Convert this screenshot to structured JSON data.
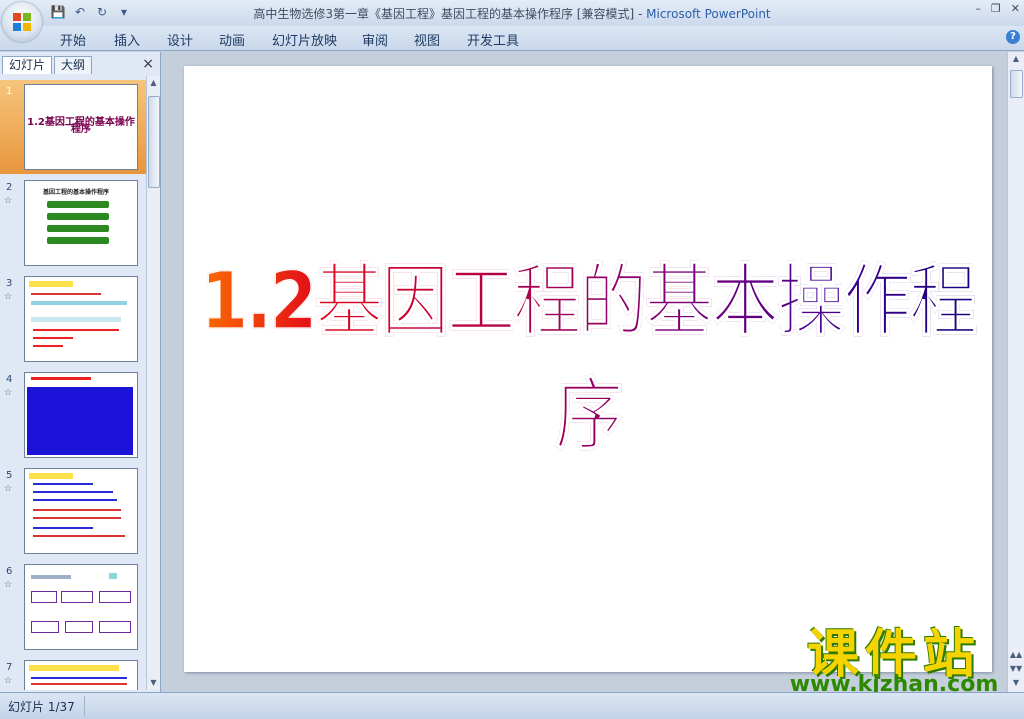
{
  "window": {
    "title": "高中生物选修3第一章《基因工程》基因工程的基本操作程序 [兼容模式]",
    "app_name": "Microsoft PowerPoint",
    "title_separator": " - "
  },
  "ribbon": {
    "tabs": [
      "开始",
      "插入",
      "设计",
      "动画",
      "幻灯片放映",
      "审阅",
      "视图",
      "开发工具"
    ]
  },
  "panel": {
    "tab_slides": "幻灯片",
    "tab_outline": "大纲",
    "close": "×"
  },
  "thumbnails": [
    {
      "num": "1",
      "star": "",
      "title": "1.2基因工程的基本操作程序"
    },
    {
      "num": "2",
      "star": "☆",
      "title": "基因工程的基本操作程序"
    },
    {
      "num": "3",
      "star": "☆",
      "title": ""
    },
    {
      "num": "4",
      "star": "☆",
      "title": ""
    },
    {
      "num": "5",
      "star": "☆",
      "title": ""
    },
    {
      "num": "6",
      "star": "☆",
      "title": ""
    },
    {
      "num": "7",
      "star": "☆",
      "title": ""
    }
  ],
  "slide": {
    "title": "1.2基因工程的基本操作程序"
  },
  "watermark": {
    "big": "课件站",
    "small": "www.kjzhan.com"
  },
  "status": {
    "slide_counter": "幻灯片 1/37"
  },
  "colors": {
    "ribbon_bg": "#dbe6f4",
    "selected_thumb": "#f2a24a",
    "watermark_yellow": "#f5d300",
    "watermark_green": "#2d8a00"
  }
}
